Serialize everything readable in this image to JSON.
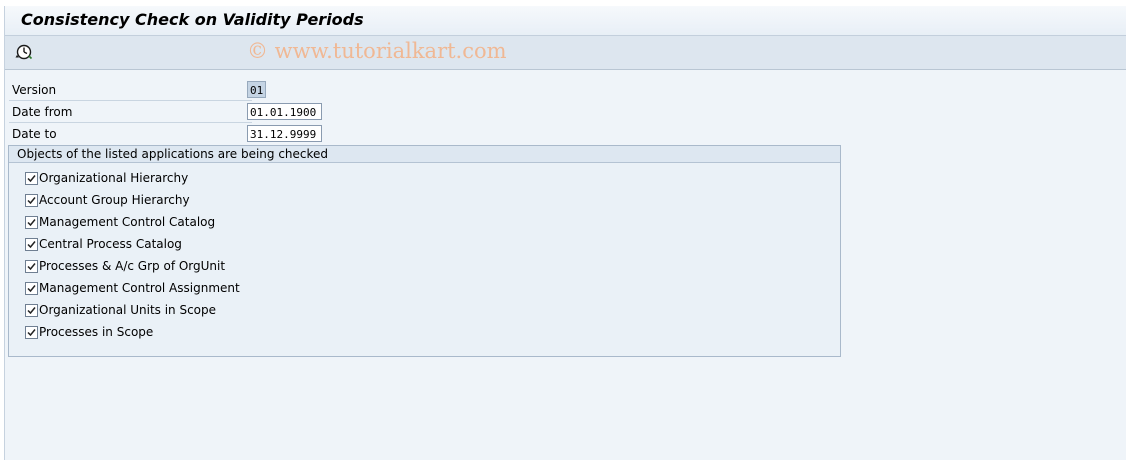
{
  "window": {
    "title": "Consistency Check on Validity Periods"
  },
  "toolbar": {
    "execute_icon": "execute-clock-icon",
    "watermark": "© www.tutorialkart.com"
  },
  "fields": {
    "version": {
      "label": "Version",
      "value": "01"
    },
    "date_from": {
      "label": "Date from",
      "value": "01.01.1900"
    },
    "date_to": {
      "label": "Date to",
      "value": "31.12.9999"
    }
  },
  "group": {
    "title": "Objects of the listed applications are being checked",
    "items": [
      {
        "label": "Organizational Hierarchy",
        "checked": true
      },
      {
        "label": "Account Group Hierarchy",
        "checked": true
      },
      {
        "label": "Management Control Catalog",
        "checked": true
      },
      {
        "label": "Central Process Catalog",
        "checked": true
      },
      {
        "label": "Processes & A/c Grp of OrgUnit",
        "checked": true
      },
      {
        "label": "Management Control Assignment",
        "checked": true
      },
      {
        "label": "Organizational Units in Scope",
        "checked": true
      },
      {
        "label": "Processes in Scope",
        "checked": true
      }
    ]
  },
  "colors": {
    "background": "#eff4f9",
    "toolbar": "#dde6ef",
    "watermark": "#f0b894"
  }
}
